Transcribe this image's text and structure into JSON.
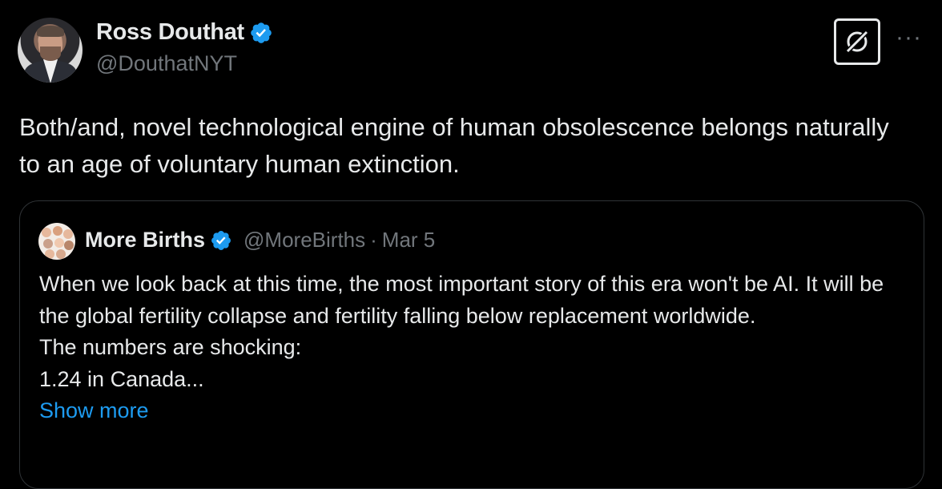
{
  "author": {
    "display_name": "Ross Douthat",
    "handle": "@DouthatNYT",
    "verified": true,
    "avatar_icon": "profile-photo"
  },
  "actions": {
    "grok_icon": "grok-icon",
    "more_label": "···"
  },
  "tweet": {
    "text": "Both/and, novel technological engine of human obsolescence belongs naturally to an age of voluntary human extinction."
  },
  "quoted": {
    "display_name": "More Births",
    "handle": "@MoreBirths",
    "separator": "·",
    "date": "Mar 5",
    "verified": true,
    "lines": [
      "When we look back at this time, the most important story of this era won't be AI. It will be the global fertility collapse and fertility falling below replacement worldwide.",
      "The numbers are shocking:",
      "1.24 in Canada..."
    ],
    "show_more": "Show more"
  },
  "colors": {
    "background": "#000000",
    "text": "#e7e9ea",
    "secondary": "#71767b",
    "accent": "#1d9bf0",
    "border": "#2f3336"
  }
}
